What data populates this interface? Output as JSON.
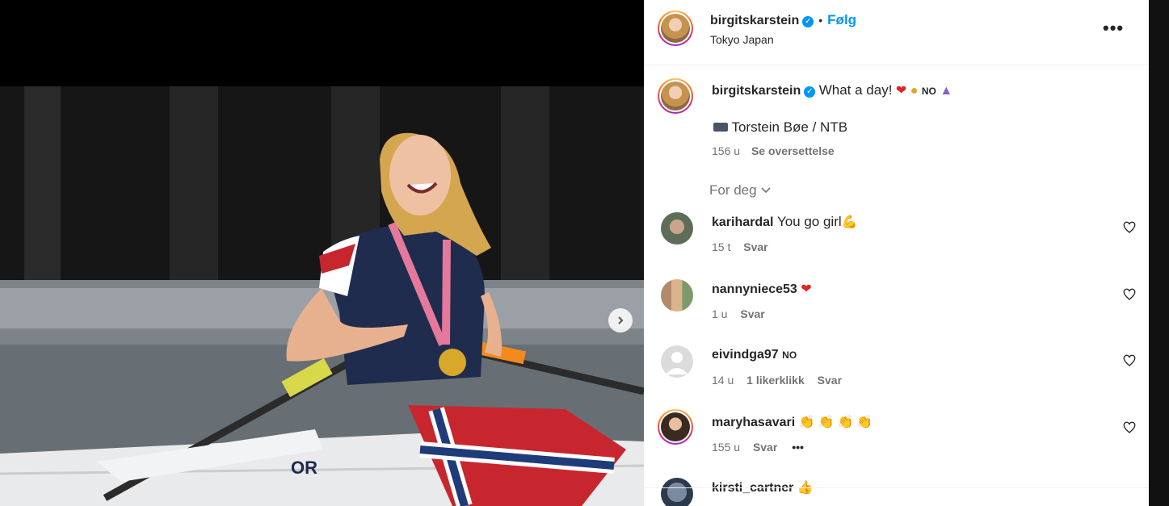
{
  "header": {
    "username": "birgitskarstein",
    "separator": "•",
    "follow_label": "Følg",
    "location": "Tokyo Japan"
  },
  "caption": {
    "username": "birgitskarstein",
    "text": "What a day!",
    "flag_text": "NO",
    "photo_credit": "Torstein Bøe / NTB",
    "time": "156 u",
    "translate_label": "Se oversettelse"
  },
  "sort": {
    "label": "For deg"
  },
  "comments": [
    {
      "username": "karihardal",
      "text": "You go girl",
      "time": "15 t",
      "reply": "Svar"
    },
    {
      "username": "nannyniece53",
      "text": "",
      "time": "1 u",
      "reply": "Svar"
    },
    {
      "username": "eivindga97",
      "text": "NO",
      "time": "14 u",
      "likes": "1 likerklikk",
      "reply": "Svar"
    },
    {
      "username": "maryhasavari",
      "text": "",
      "time": "155 u",
      "reply": "Svar"
    },
    {
      "username": "kirsti_cartner",
      "text": ""
    }
  ],
  "colors": {
    "link": "#0095f6",
    "text": "#262626",
    "meta": "#737373",
    "boat_text": "OR"
  },
  "icons": [
    "verified-icon",
    "more-options-icon",
    "heart-icon",
    "chevron-down-icon",
    "chevron-right-icon",
    "camera-icon"
  ]
}
